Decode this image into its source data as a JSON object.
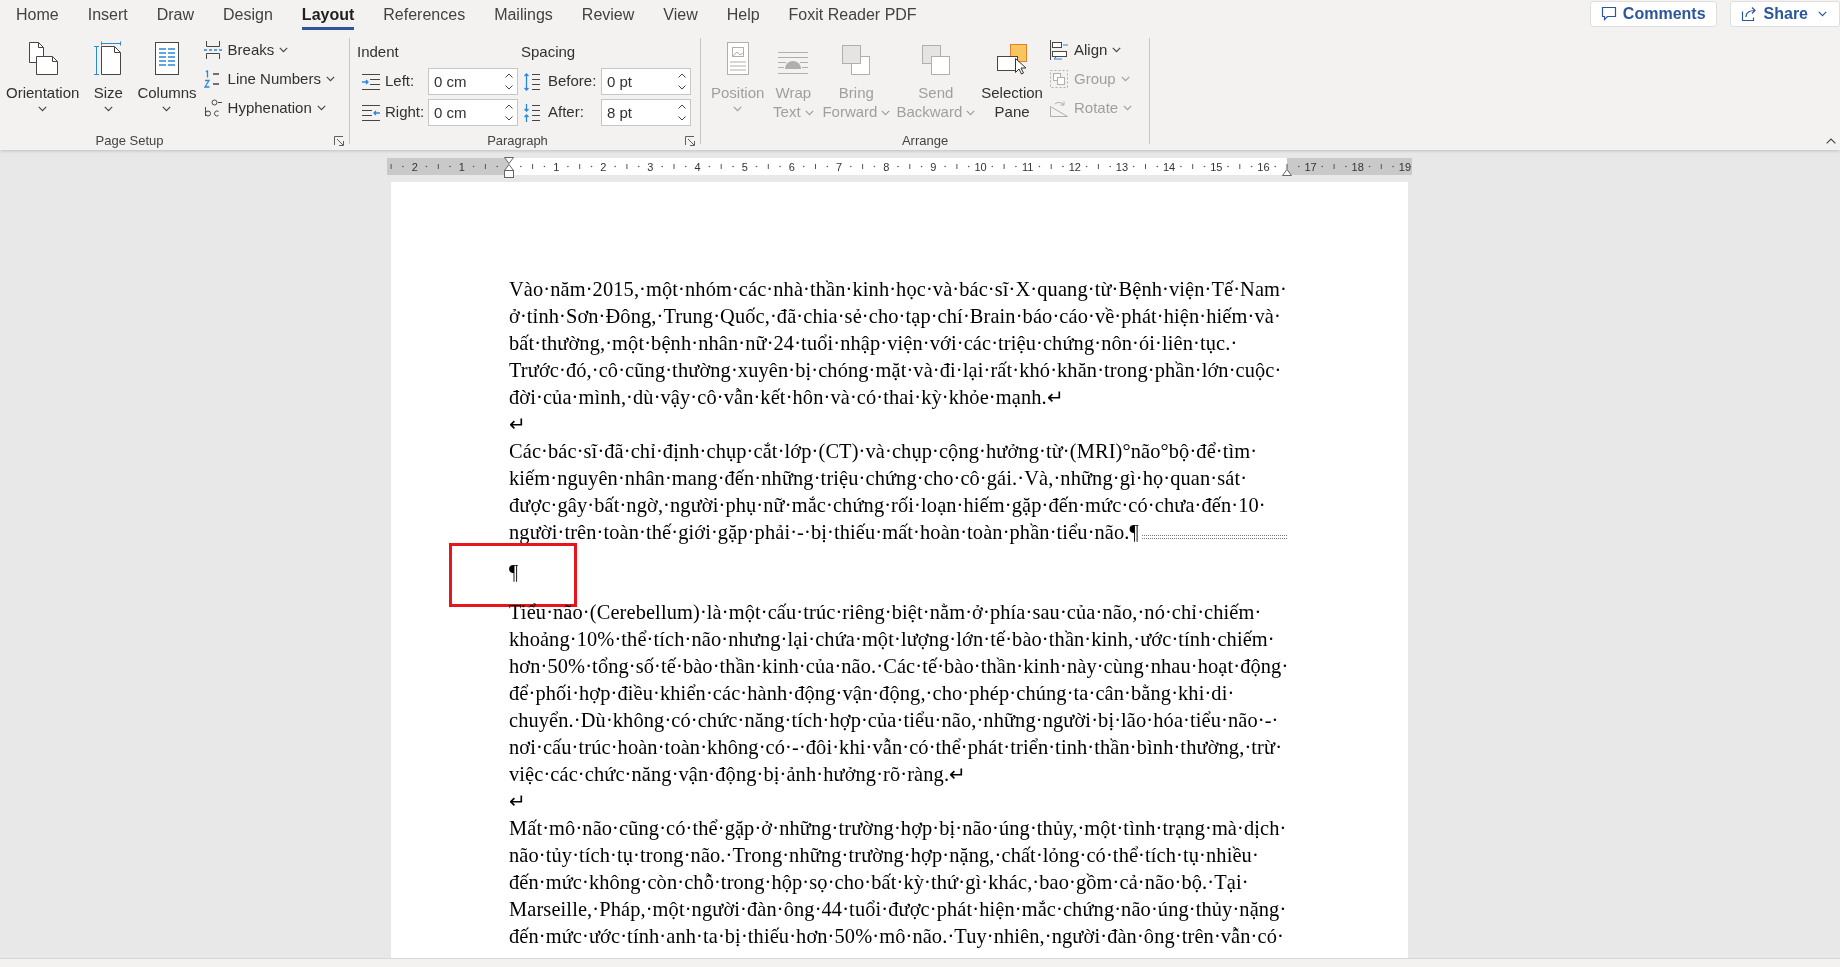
{
  "tabs": [
    {
      "label": "Home",
      "selected": false
    },
    {
      "label": "Insert",
      "selected": false
    },
    {
      "label": "Draw",
      "selected": false
    },
    {
      "label": "Design",
      "selected": false
    },
    {
      "label": "Layout",
      "selected": true
    },
    {
      "label": "References",
      "selected": false
    },
    {
      "label": "Mailings",
      "selected": false
    },
    {
      "label": "Review",
      "selected": false
    },
    {
      "label": "View",
      "selected": false
    },
    {
      "label": "Help",
      "selected": false
    },
    {
      "label": "Foxit Reader PDF",
      "selected": false
    }
  ],
  "header_buttons": [
    {
      "kind": "comments",
      "label": "Comments",
      "dropdown": false
    },
    {
      "kind": "share",
      "label": "Share",
      "dropdown": true
    }
  ],
  "ribbon": {
    "page_setup": {
      "title": "Page Setup",
      "launcher": true,
      "large_buttons": [
        {
          "kind": "orientation",
          "label_lines": [
            "Orientation"
          ],
          "dropdown": true
        },
        {
          "kind": "size",
          "label_lines": [
            "Size"
          ],
          "dropdown": true
        },
        {
          "kind": "columns",
          "label_lines": [
            "Columns"
          ],
          "dropdown": true
        }
      ],
      "small_buttons": [
        {
          "kind": "breaks",
          "label": "Breaks",
          "dropdown": true
        },
        {
          "kind": "line-numbers",
          "label": "Line Numbers",
          "dropdown": true
        },
        {
          "kind": "hyphenation",
          "label": "Hyphenation",
          "dropdown": true
        }
      ]
    },
    "paragraph": {
      "title": "Paragraph",
      "launcher": true,
      "sections": [
        {
          "kind": "indent",
          "title": "Indent",
          "fields": [
            {
              "kind": "indent-left",
              "label": "Left:",
              "value": "0 cm"
            },
            {
              "kind": "indent-right",
              "label": "Right:",
              "value": "0 cm"
            }
          ]
        },
        {
          "kind": "spacing",
          "title": "Spacing",
          "fields": [
            {
              "kind": "space-before",
              "label": "Before:",
              "value": "0 pt"
            },
            {
              "kind": "space-after",
              "label": "After:",
              "value": "8 pt"
            }
          ]
        }
      ]
    },
    "arrange": {
      "title": "Arrange",
      "large_buttons": [
        {
          "kind": "position",
          "label_lines": [
            "Position"
          ],
          "dropdown": true,
          "disabled": true
        },
        {
          "kind": "wrap-text",
          "label_lines": [
            "Wrap",
            "Text"
          ],
          "dropdown": true,
          "disabled": true
        },
        {
          "kind": "bring-forward",
          "label_lines": [
            "Bring",
            "Forward"
          ],
          "dropdown": true,
          "disabled": true
        },
        {
          "kind": "send-backward",
          "label_lines": [
            "Send",
            "Backward"
          ],
          "dropdown": true,
          "disabled": true
        },
        {
          "kind": "selection-pane",
          "label_lines": [
            "Selection",
            "Pane"
          ],
          "dropdown": false,
          "disabled": false
        }
      ],
      "small_buttons": [
        {
          "kind": "align",
          "label": "Align",
          "dropdown": true,
          "disabled": false
        },
        {
          "kind": "group",
          "label": "Group",
          "dropdown": true,
          "disabled": true
        },
        {
          "kind": "rotate",
          "label": "Rotate",
          "dropdown": true,
          "disabled": true
        }
      ]
    }
  },
  "ruler": {
    "left_numbers": [
      "2",
      "1"
    ],
    "numbers": [
      "1",
      "2",
      "3",
      "4",
      "5",
      "6",
      "7",
      "8",
      "9",
      "10",
      "11",
      "12",
      "13",
      "14",
      "15",
      "16",
      "17",
      "18",
      "19"
    ]
  },
  "document": {
    "blocks": [
      {
        "kind": "line-break",
        "highlighted": false,
        "lines": [
          "Vào·năm·2015,·một·nhóm·các·nhà·thần·kinh·học·và·bác·sĩ·X·quang·từ·Bệnh·viện·Tế·Nam·",
          "ở·tỉnh·Sơn·Đông,·Trung·Quốc,·đã·chia·sẻ·cho·tạp·chí·Brain·báo·cáo·về·phát·hiện·hiếm·và·",
          "bất·thường,·một·bệnh·nhân·nữ·24·tuổi·nhập·viện·với·các·triệu·chứng·nôn·ói·liên·tục.·",
          "Trước·đó,·cô·cũng·thường·xuyên·bị·chóng·mặt·và·đi·lại·rất·khó·khăn·trong·phần·lớn·cuộc·",
          "đời·của·mình,·dù·vậy·cô·vẫn·kết·hôn·và·có·thai·kỳ·khỏe·mạnh.↵"
        ]
      },
      {
        "kind": "line-break",
        "highlighted": false,
        "lines": [
          "↵"
        ]
      },
      {
        "kind": "section-break",
        "highlighted": false,
        "lines": [
          "Các·bác·sĩ·đã·chỉ·định·chụp·cắt·lớp·(CT)·và·chụp·cộng·hưởng·từ·(MRI)°não°bộ·để·tìm·",
          "kiếm·nguyên·nhân·mang·đến·những·triệu·chứng·cho·cô·gái.·Và,·những·gì·họ·quan·sát·",
          "được·gây·bất·ngờ,·người·phụ·nữ·mắc·chứng·rối·loạn·hiếm·gặp·đến·mức·có·chưa·đến·10·",
          "người·trên·toàn·thế·giới·gặp·phải·-·bị·thiếu·mất·hoàn·toàn·phần·tiểu·não.¶"
        ]
      },
      {
        "kind": "paragraph",
        "highlighted": true,
        "lines": [
          "¶"
        ]
      },
      {
        "kind": "line-break",
        "highlighted": false,
        "lines": [
          "Tiểu·não·(Cerebellum)·là·một·cấu·trúc·riêng·biệt·nằm·ở·phía·sau·của·não,·nó·chỉ·chiếm·",
          "khoảng·10%·thể·tích·não·nhưng·lại·chứa·một·lượng·lớn·tế·bào·thần·kinh,·ước·tính·chiếm·",
          "hơn·50%·tổng·số·tế·bào·thần·kinh·của·não.·Các·tế·bào·thần·kinh·này·cùng·nhau·hoạt·động·",
          "để·phối·hợp·điều·khiển·các·hành·động·vận·động,·cho·phép·chúng·ta·cân·bằng·khi·di·",
          "chuyển.·Dù·không·có·chức·năng·tích·hợp·của·tiểu·não,·những·người·bị·lão·hóa·tiểu·não·-·",
          "nơi·cấu·trúc·hoàn·toàn·không·có·-·đôi·khi·vẫn·có·thể·phát·triển·tinh·thần·bình·thường,·trừ·",
          "việc·các·chức·năng·vận·động·bị·ảnh·hưởng·rõ·ràng.↵"
        ]
      },
      {
        "kind": "line-break",
        "highlighted": false,
        "lines": [
          "↵"
        ]
      },
      {
        "kind": "paragraph",
        "highlighted": false,
        "lines": [
          "Mất·mô·não·cũng·có·thể·gặp·ở·những·trường·hợp·bị·não·úng·thủy,·một·tình·trạng·mà·dịch·",
          "não·tủy·tích·tụ·trong·não.·Trong·những·trường·hợp·nặng,·chất·lỏng·có·thể·tích·tụ·nhiều·",
          "đến·mức·không·còn·chỗ·trong·hộp·sọ·cho·bất·kỳ·thứ·gì·khác,·bao·gồm·cả·não·bộ.·Tại·",
          "Marseille,·Pháp,·một·người·đàn·ông·44·tuổi·được·phát·hiện·mắc·chứng·não·úng·thủy·nặng·",
          "đến·mức·ước·tính·anh·ta·bị·thiếu·hơn·50%·mô·não.·Tuy·nhiên,·người·đàn·ông·trên·vẫn·có·"
        ]
      }
    ]
  }
}
